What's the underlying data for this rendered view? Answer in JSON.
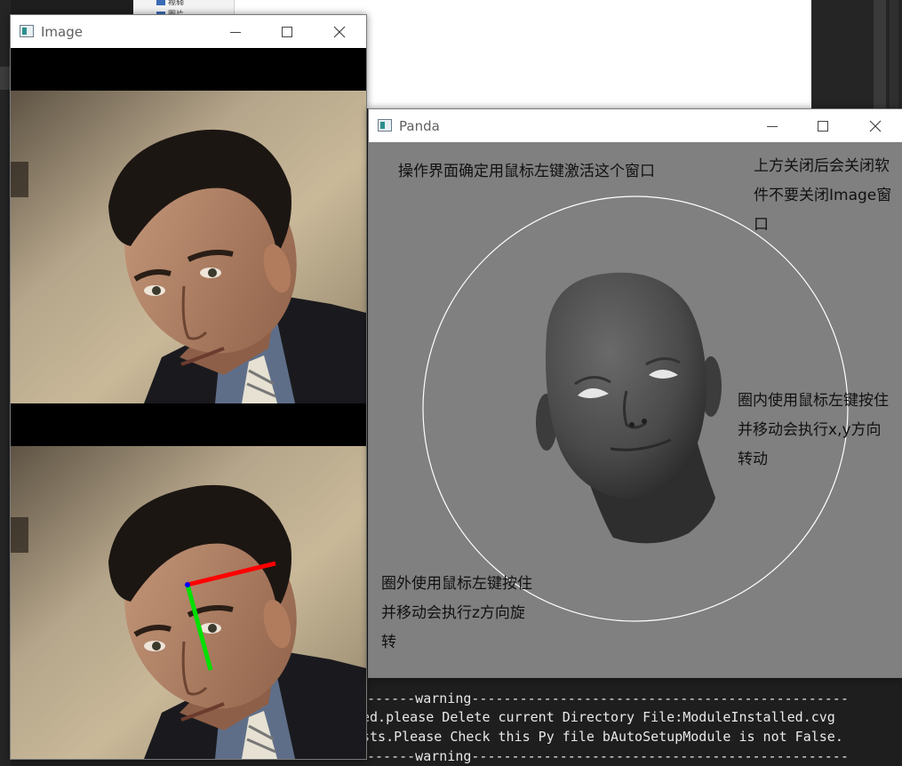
{
  "background": {
    "explorer_items": [
      "视频",
      "图片"
    ],
    "console_lines": [
      "------warning-----------------------------------------------",
      "ed.please Delete current Directory File:ModuleInstalled.cvg",
      "sts.Please Check this Py file bAutoSetupModule is not False.",
      "------warning-----------------------------------------------"
    ]
  },
  "image_window": {
    "title": "Image",
    "controls": {
      "minimize": "minimize-icon",
      "maximize": "maximize-icon",
      "close": "close-icon"
    },
    "axis_colors": {
      "x": "#ff0000",
      "y": "#00e000",
      "origin": "#0000ff"
    }
  },
  "panda_window": {
    "title": "Panda",
    "controls": {
      "minimize": "minimize-icon",
      "maximize": "maximize-icon",
      "close": "close-icon"
    },
    "hints": {
      "top_left": "操作界面确定用鼠标左键激活这个窗口",
      "top_right": [
        "上方关闭后会关闭软",
        "件不要关闭Image窗",
        "口"
      ],
      "inside_circle": [
        "圈内使用鼠标左键按住",
        "并移动会执行x,y方向",
        "转动"
      ],
      "outside_circle": [
        "圈外使用鼠标左键按住",
        "并移动会执行z方向旋",
        "转"
      ]
    },
    "background_color": "#808080",
    "circle_color": "#ffffff"
  }
}
